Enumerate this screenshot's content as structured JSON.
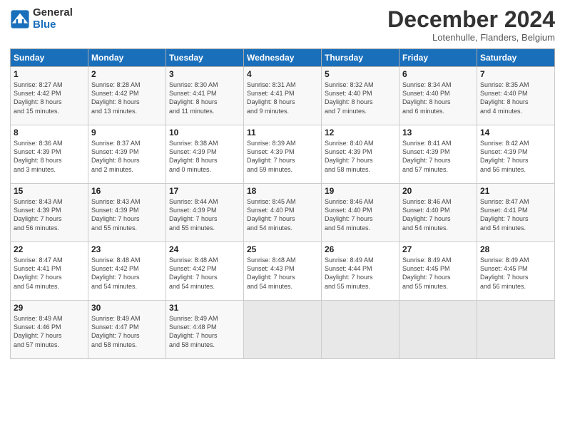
{
  "header": {
    "logo_general": "General",
    "logo_blue": "Blue",
    "title": "December 2024",
    "subtitle": "Lotenhulle, Flanders, Belgium"
  },
  "days_of_week": [
    "Sunday",
    "Monday",
    "Tuesday",
    "Wednesday",
    "Thursday",
    "Friday",
    "Saturday"
  ],
  "weeks": [
    [
      {
        "day": "1",
        "info": "Sunrise: 8:27 AM\nSunset: 4:42 PM\nDaylight: 8 hours\nand 15 minutes."
      },
      {
        "day": "2",
        "info": "Sunrise: 8:28 AM\nSunset: 4:42 PM\nDaylight: 8 hours\nand 13 minutes."
      },
      {
        "day": "3",
        "info": "Sunrise: 8:30 AM\nSunset: 4:41 PM\nDaylight: 8 hours\nand 11 minutes."
      },
      {
        "day": "4",
        "info": "Sunrise: 8:31 AM\nSunset: 4:41 PM\nDaylight: 8 hours\nand 9 minutes."
      },
      {
        "day": "5",
        "info": "Sunrise: 8:32 AM\nSunset: 4:40 PM\nDaylight: 8 hours\nand 7 minutes."
      },
      {
        "day": "6",
        "info": "Sunrise: 8:34 AM\nSunset: 4:40 PM\nDaylight: 8 hours\nand 6 minutes."
      },
      {
        "day": "7",
        "info": "Sunrise: 8:35 AM\nSunset: 4:40 PM\nDaylight: 8 hours\nand 4 minutes."
      }
    ],
    [
      {
        "day": "8",
        "info": "Sunrise: 8:36 AM\nSunset: 4:39 PM\nDaylight: 8 hours\nand 3 minutes."
      },
      {
        "day": "9",
        "info": "Sunrise: 8:37 AM\nSunset: 4:39 PM\nDaylight: 8 hours\nand 2 minutes."
      },
      {
        "day": "10",
        "info": "Sunrise: 8:38 AM\nSunset: 4:39 PM\nDaylight: 8 hours\nand 0 minutes."
      },
      {
        "day": "11",
        "info": "Sunrise: 8:39 AM\nSunset: 4:39 PM\nDaylight: 7 hours\nand 59 minutes."
      },
      {
        "day": "12",
        "info": "Sunrise: 8:40 AM\nSunset: 4:39 PM\nDaylight: 7 hours\nand 58 minutes."
      },
      {
        "day": "13",
        "info": "Sunrise: 8:41 AM\nSunset: 4:39 PM\nDaylight: 7 hours\nand 57 minutes."
      },
      {
        "day": "14",
        "info": "Sunrise: 8:42 AM\nSunset: 4:39 PM\nDaylight: 7 hours\nand 56 minutes."
      }
    ],
    [
      {
        "day": "15",
        "info": "Sunrise: 8:43 AM\nSunset: 4:39 PM\nDaylight: 7 hours\nand 56 minutes."
      },
      {
        "day": "16",
        "info": "Sunrise: 8:43 AM\nSunset: 4:39 PM\nDaylight: 7 hours\nand 55 minutes."
      },
      {
        "day": "17",
        "info": "Sunrise: 8:44 AM\nSunset: 4:39 PM\nDaylight: 7 hours\nand 55 minutes."
      },
      {
        "day": "18",
        "info": "Sunrise: 8:45 AM\nSunset: 4:40 PM\nDaylight: 7 hours\nand 54 minutes."
      },
      {
        "day": "19",
        "info": "Sunrise: 8:46 AM\nSunset: 4:40 PM\nDaylight: 7 hours\nand 54 minutes."
      },
      {
        "day": "20",
        "info": "Sunrise: 8:46 AM\nSunset: 4:40 PM\nDaylight: 7 hours\nand 54 minutes."
      },
      {
        "day": "21",
        "info": "Sunrise: 8:47 AM\nSunset: 4:41 PM\nDaylight: 7 hours\nand 54 minutes."
      }
    ],
    [
      {
        "day": "22",
        "info": "Sunrise: 8:47 AM\nSunset: 4:41 PM\nDaylight: 7 hours\nand 54 minutes."
      },
      {
        "day": "23",
        "info": "Sunrise: 8:48 AM\nSunset: 4:42 PM\nDaylight: 7 hours\nand 54 minutes."
      },
      {
        "day": "24",
        "info": "Sunrise: 8:48 AM\nSunset: 4:42 PM\nDaylight: 7 hours\nand 54 minutes."
      },
      {
        "day": "25",
        "info": "Sunrise: 8:48 AM\nSunset: 4:43 PM\nDaylight: 7 hours\nand 54 minutes."
      },
      {
        "day": "26",
        "info": "Sunrise: 8:49 AM\nSunset: 4:44 PM\nDaylight: 7 hours\nand 55 minutes."
      },
      {
        "day": "27",
        "info": "Sunrise: 8:49 AM\nSunset: 4:45 PM\nDaylight: 7 hours\nand 55 minutes."
      },
      {
        "day": "28",
        "info": "Sunrise: 8:49 AM\nSunset: 4:45 PM\nDaylight: 7 hours\nand 56 minutes."
      }
    ],
    [
      {
        "day": "29",
        "info": "Sunrise: 8:49 AM\nSunset: 4:46 PM\nDaylight: 7 hours\nand 57 minutes."
      },
      {
        "day": "30",
        "info": "Sunrise: 8:49 AM\nSunset: 4:47 PM\nDaylight: 7 hours\nand 58 minutes."
      },
      {
        "day": "31",
        "info": "Sunrise: 8:49 AM\nSunset: 4:48 PM\nDaylight: 7 hours\nand 58 minutes."
      },
      {
        "day": "",
        "info": ""
      },
      {
        "day": "",
        "info": ""
      },
      {
        "day": "",
        "info": ""
      },
      {
        "day": "",
        "info": ""
      }
    ]
  ]
}
